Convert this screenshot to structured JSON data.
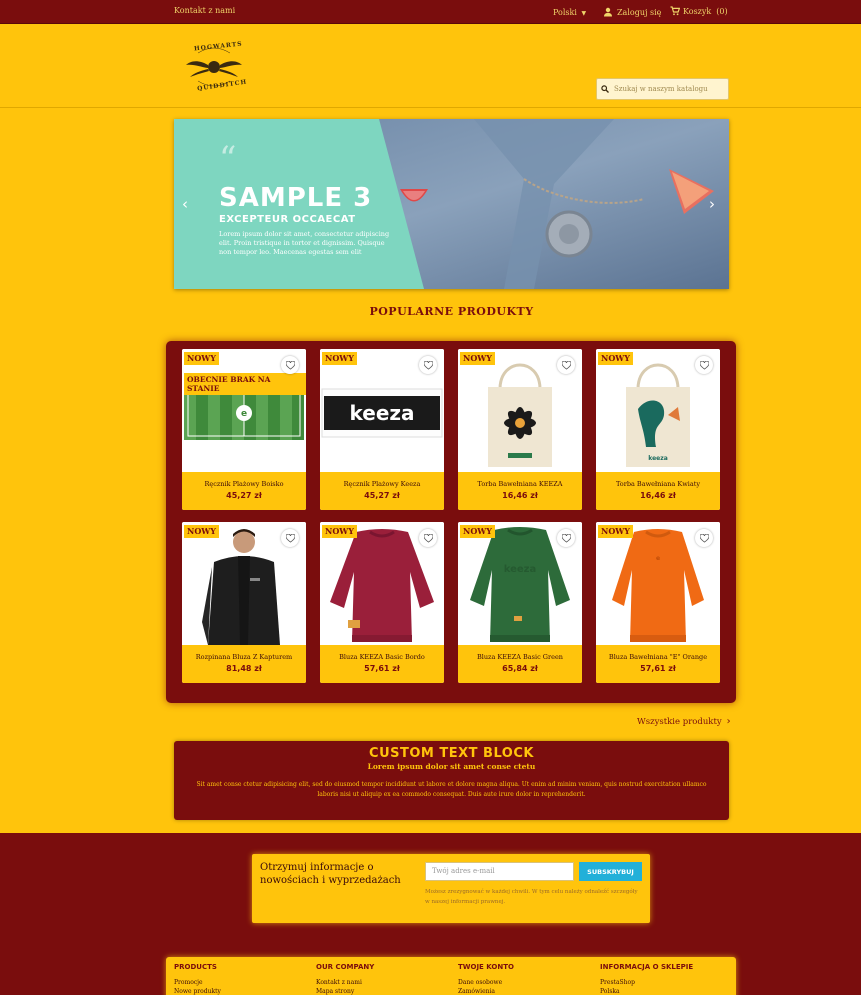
{
  "topbar": {
    "contact": "Kontakt z nami",
    "language": "Polski",
    "login": "Zaloguj się",
    "cart": "Koszyk",
    "cart_count": "(0)"
  },
  "header": {
    "logo_text_top": "HOGWARTS",
    "logo_text_bottom": "QUIDDITCH",
    "search_placeholder": "Szukaj w naszym katalogu"
  },
  "slider": {
    "title": "SAMPLE 3",
    "subtitle": "EXCEPTEUR OCCAECAT",
    "description": "Lorem ipsum dolor sit amet, consectetur adipiscing elit. Proin tristique in tortor et dignissim. Quisque non tempor leo. Maecenas egestas sem elit",
    "prev_icon": "chevron-left-icon",
    "next_icon": "chevron-right-icon"
  },
  "popular_title": "POPULARNE PRODUKTY",
  "products": [
    {
      "name": "Ręcznik Plażowy Boisko",
      "price": "45,27 zł",
      "badge": "NOWY",
      "extra_badge": "OBECNIE BRAK NA STANIE"
    },
    {
      "name": "Ręcznik Plażowy Keeza",
      "price": "45,27 zł",
      "badge": "NOWY"
    },
    {
      "name": "Torba Bawełniana KEEZA",
      "price": "16,46 zł",
      "badge": "NOWY"
    },
    {
      "name": "Torba Bawełniana Kwiaty",
      "price": "16,46 zł",
      "badge": "NOWY"
    },
    {
      "name": "Rozpinana Bluza Z Kapturem",
      "price": "81,48 zł",
      "badge": "NOWY"
    },
    {
      "name": "Bluza KEEZA Basic Bordo",
      "price": "57,61 zł",
      "badge": "NOWY"
    },
    {
      "name": "Bluza KEEZA Basic Green",
      "price": "65,84 zł",
      "badge": "NOWY"
    },
    {
      "name": "Bluza Bawełniana \"E\" Orange",
      "price": "57,61 zł",
      "badge": "NOWY"
    }
  ],
  "all_products": "Wszystkie produkty",
  "custom_block": {
    "title": "CUSTOM TEXT BLOCK",
    "subtitle": "Lorem ipsum dolor sit amet conse ctetu",
    "text": "Sit amet conse ctetur adipisicing elit, sed do eiusmod tempor incididunt ut labore et dolore magna aliqua. Ut enim ad minim veniam, quis nostrud exercitation ullamco laboris nisi ut aliquip ex ea commodo consequat. Duis aute irure dolor in reprehenderit."
  },
  "newsletter": {
    "title": "Otrzymuj informacje o nowościach i wyprzedażach",
    "placeholder": "Twój adres e-mail",
    "button": "SUBSKRYBUJ",
    "note": "Możesz zrezygnować w każdej chwili. W tym celu należy odnaleźć szczegóły w naszej informacji prawnej."
  },
  "footer": {
    "columns": [
      {
        "heading": "PRODUCTS",
        "links": [
          "Promocje",
          "Nowe produkty"
        ]
      },
      {
        "heading": "OUR COMPANY",
        "links": [
          "Kontakt z nami",
          "Mapa strony"
        ]
      },
      {
        "heading": "TWOJE KONTO",
        "links": [
          "Dane osobowe",
          "Zamówienia"
        ]
      },
      {
        "heading": "INFORMACJA O SKLEPIE",
        "links": [
          "PrestaShop",
          "Polska"
        ]
      }
    ]
  },
  "colors": {
    "brand_red": "#7a0d0d",
    "brand_yellow": "#ffc40c",
    "slide_teal": "#7ed6c0",
    "subscribe_blue": "#22b0d9"
  }
}
